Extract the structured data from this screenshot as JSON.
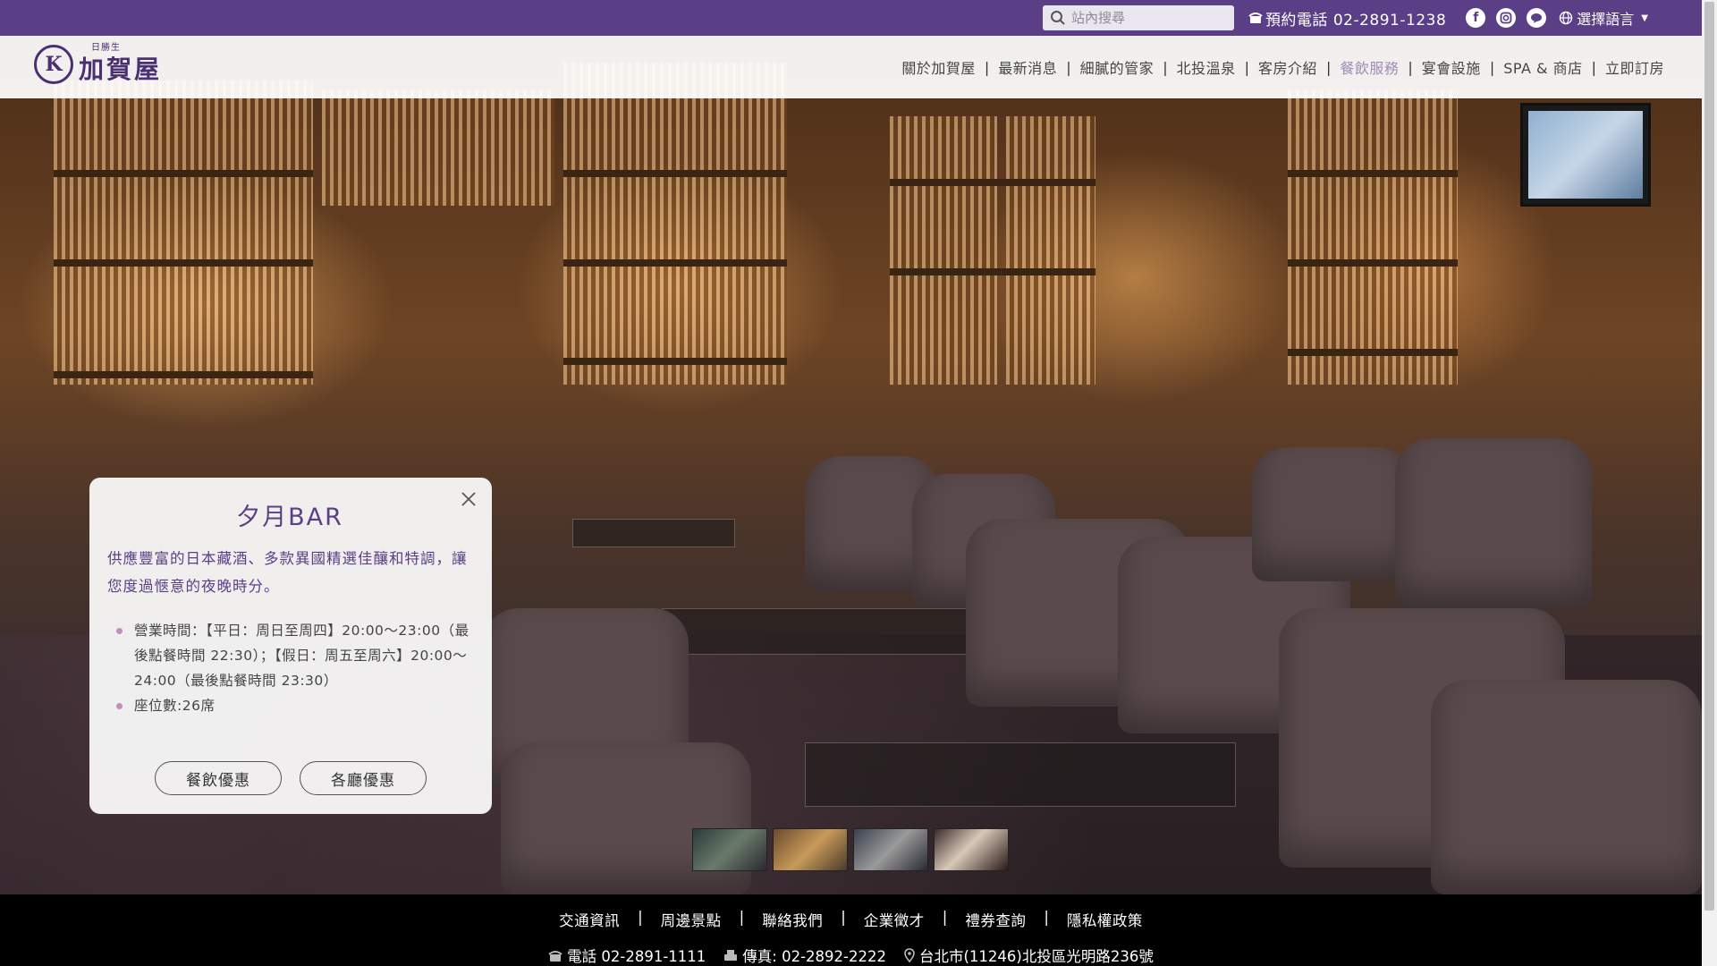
{
  "topbar": {
    "search_placeholder": "站內搜尋",
    "phone_label": "預約電話 02-2891-1238",
    "language_label": "選擇語言",
    "social": [
      "facebook-icon",
      "instagram-icon",
      "line-icon"
    ]
  },
  "logo": {
    "small": "日勝生",
    "big": "加賀屋"
  },
  "nav": {
    "items": [
      "關於加賀屋",
      "最新消息",
      "細膩的管家",
      "北投溫泉",
      "客房介紹",
      "餐飲服務",
      "宴會設施",
      "SPA & 商店",
      "立即訂房"
    ],
    "active_index": 5,
    "separator": "|"
  },
  "card": {
    "title": "夕月BAR",
    "description": "供應豐富的日本藏酒、多款異國精選佳釀和特調，讓您度過愜意的夜晚時分。",
    "details": [
      "營業時間：【平日：周日至周四】20:00～23:00（最後點餐時間 22:30）；【假日：周五至周六】20:00～24:00（最後點餐時間 23:30）",
      "座位數:26席"
    ],
    "buttons": [
      "餐飲優惠",
      "各廳優惠"
    ]
  },
  "thumbnails": {
    "count": 4,
    "active_index": 3
  },
  "footer": {
    "links": [
      "交通資訊",
      "周邊景點",
      "聯絡我們",
      "企業徵才",
      "禮券查詢",
      "隱私權政策"
    ],
    "separator": "|",
    "phone": "電話 02-2891-1111",
    "fax": "傳真: 02-2892-2222",
    "address": "台北市(11246)北投區光明路236號"
  },
  "colors": {
    "brand_purple": "#5a3f87",
    "active_nav": "#a08bb8",
    "bullet": "#c48dbb"
  }
}
